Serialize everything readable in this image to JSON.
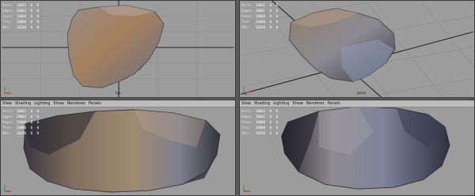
{
  "menu": [
    "View",
    "Shading",
    "Lighting",
    "Show",
    "Renderer",
    "Panels"
  ],
  "hud": {
    "labels": [
      "Verts:",
      "Edges:",
      "Faces:",
      "Tris:",
      "UVs:"
    ],
    "values": [
      "10042",
      "20082",
      "20000",
      "20000",
      "10240"
    ],
    "zeros": [
      "0",
      "0",
      "0",
      "0",
      "0"
    ]
  },
  "viewports": {
    "top_left": {
      "camera": "top"
    },
    "top_right": {
      "camera": "persp"
    },
    "bottom_left": {
      "camera": ""
    },
    "bottom_right": {
      "camera": ""
    }
  },
  "colors": {
    "viewport_bg": "#9c9c9c",
    "grid_line": "#8a8a8a",
    "axis_line": "#111111",
    "rock_shadow": "#2b2a30",
    "rock_warm": "#8a7560",
    "rock_cool": "#7b7f92"
  }
}
